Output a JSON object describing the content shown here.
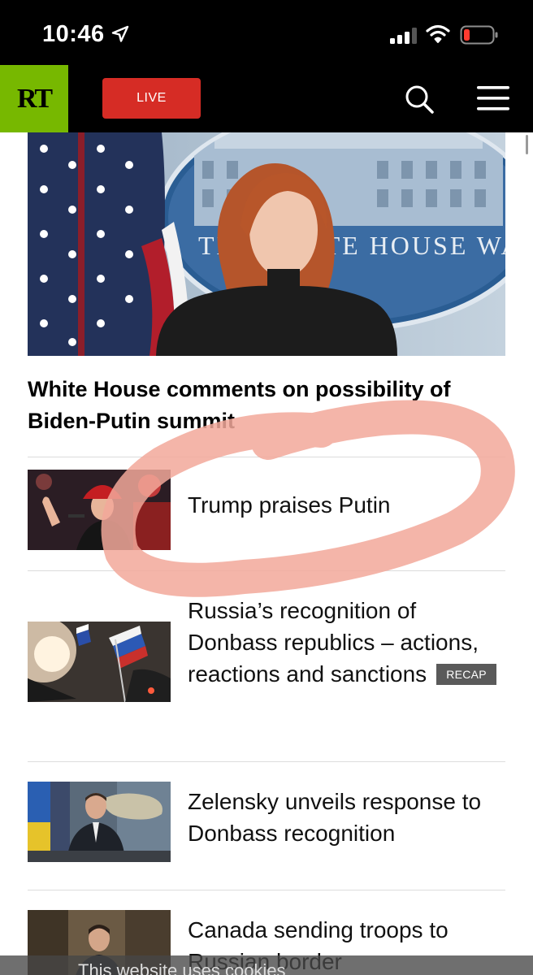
{
  "status_bar": {
    "time": "10:46",
    "icons": [
      "location-arrow-icon",
      "signal-icon",
      "wifi-icon",
      "battery-low-icon"
    ]
  },
  "nav": {
    "logo_text": "RT",
    "live_label": "LIVE",
    "icons": [
      "search-icon",
      "hamburger-menu-icon"
    ],
    "colors": {
      "logo_bg": "#77b800",
      "live_bg": "#d62c25",
      "nav_bg": "#000000"
    }
  },
  "hero": {
    "image_sign_text": "THE WHITE HOUSE WASHINGTON",
    "headline": "White House comments on possibility of Biden-Putin summit"
  },
  "articles": [
    {
      "title": "Trump praises Putin",
      "badge": ""
    },
    {
      "title": "Russia’s recognition of Donbass republics – actions, reactions and sanctions",
      "badge": "RECAP"
    },
    {
      "title": "Zelensky unveils response to Donbass recognition",
      "badge": ""
    },
    {
      "title": "Canada sending troops to Russian border",
      "badge": ""
    }
  ],
  "cookie_bar": {
    "text": "This website uses cookies"
  },
  "annotation": {
    "color": "#f2a89a"
  }
}
